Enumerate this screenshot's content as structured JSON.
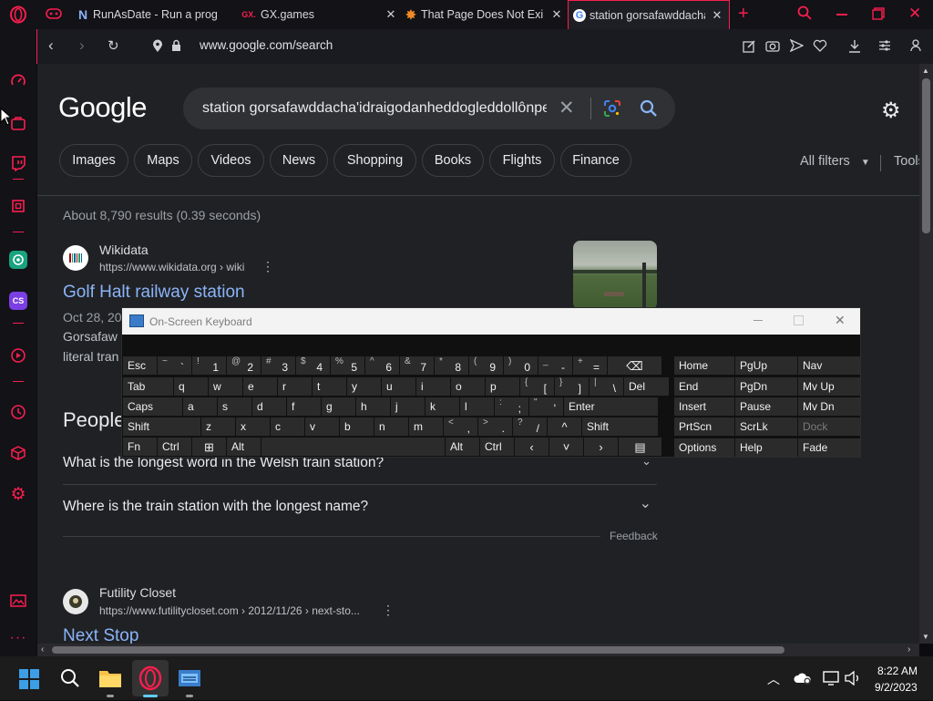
{
  "colors": {
    "accent": "#fa1e4e",
    "link": "#8ab4f8",
    "page_bg": "#202124"
  },
  "tabs": [
    {
      "title": "RunAsDate - Run a prog",
      "icon": "nirsoft-icon",
      "active": false
    },
    {
      "title": "GX.games",
      "icon": "gx-games-icon",
      "active": false
    },
    {
      "title": "That Page Does Not Exi",
      "icon": "star-splat-icon",
      "active": false
    },
    {
      "title": "station gorsafawddacha",
      "icon": "google-icon",
      "active": true
    }
  ],
  "address": {
    "url": "www.google.com/search"
  },
  "google": {
    "logo": "Google",
    "query": "station gorsafawddacha'idraigodanheddogleddollônpe",
    "chips": [
      "Images",
      "Maps",
      "Videos",
      "News",
      "Shopping",
      "Books",
      "Flights",
      "Finance"
    ],
    "all_filters": "All filters",
    "tools": "Tools",
    "stats": "About 8,790 results (0.39 seconds)"
  },
  "results": [
    {
      "site": "Wikidata",
      "url": "https://www.wikidata.org › wiki",
      "title": "Golf Halt railway station",
      "date": "Oct 28, 20",
      "snippet1": "Gorsafaw",
      "snippet2": "literal tran"
    },
    {
      "site": "Futility Closet",
      "url": "https://www.futilitycloset.com › 2012/11/26 › next-sto...",
      "title": "Next Stop"
    }
  ],
  "people_also_ask": {
    "heading": "People",
    "questions": [
      "What is the longest word in the Welsh train station?",
      "Where is the train station with the longest name?"
    ],
    "feedback": "Feedback"
  },
  "osk": {
    "title": "On-Screen Keyboard",
    "keys": {
      "row1": [
        {
          "main": "Esc"
        },
        {
          "shift": "~",
          "main": "`"
        },
        {
          "shift": "!",
          "main": "1"
        },
        {
          "shift": "@",
          "main": "2"
        },
        {
          "shift": "#",
          "main": "3"
        },
        {
          "shift": "$",
          "main": "4"
        },
        {
          "shift": "%",
          "main": "5"
        },
        {
          "shift": "^",
          "main": "6"
        },
        {
          "shift": "&",
          "main": "7"
        },
        {
          "shift": "*",
          "main": "8"
        },
        {
          "shift": "(",
          "main": "9"
        },
        {
          "shift": ")",
          "main": "0"
        },
        {
          "shift": "_",
          "main": "-"
        },
        {
          "shift": "+",
          "main": "="
        },
        {
          "main": "⌫"
        }
      ],
      "row2": [
        {
          "main": "Tab"
        },
        {
          "main": "q"
        },
        {
          "main": "w"
        },
        {
          "main": "e"
        },
        {
          "main": "r"
        },
        {
          "main": "t"
        },
        {
          "main": "y"
        },
        {
          "main": "u"
        },
        {
          "main": "i"
        },
        {
          "main": "o"
        },
        {
          "main": "p"
        },
        {
          "shift": "{",
          "main": "["
        },
        {
          "shift": "}",
          "main": "]"
        },
        {
          "shift": "|",
          "main": "\\"
        },
        {
          "main": "Del"
        }
      ],
      "row3": [
        {
          "main": "Caps"
        },
        {
          "main": "a"
        },
        {
          "main": "s"
        },
        {
          "main": "d"
        },
        {
          "main": "f"
        },
        {
          "main": "g"
        },
        {
          "main": "h"
        },
        {
          "main": "j"
        },
        {
          "main": "k"
        },
        {
          "main": "l"
        },
        {
          "shift": ":",
          "main": ";"
        },
        {
          "shift": "\"",
          "main": "'"
        },
        {
          "main": "Enter"
        }
      ],
      "row4": [
        {
          "main": "Shift"
        },
        {
          "main": "z"
        },
        {
          "main": "x"
        },
        {
          "main": "c"
        },
        {
          "main": "v"
        },
        {
          "main": "b"
        },
        {
          "main": "n"
        },
        {
          "main": "m"
        },
        {
          "shift": "<",
          "main": ","
        },
        {
          "shift": ">",
          "main": "."
        },
        {
          "shift": "?",
          "main": "/"
        },
        {
          "main": "^"
        },
        {
          "main": "Shift"
        }
      ],
      "row5": [
        {
          "main": "Fn"
        },
        {
          "main": "Ctrl"
        },
        {
          "main": "⊞"
        },
        {
          "main": "Alt"
        },
        {
          "main": ""
        },
        {
          "main": "Alt"
        },
        {
          "main": "Ctrl"
        },
        {
          "main": "‹"
        },
        {
          "main": "˅"
        },
        {
          "main": "›"
        },
        {
          "main": "▤"
        }
      ],
      "nav": [
        [
          "Home",
          "PgUp",
          "Nav"
        ],
        [
          "End",
          "PgDn",
          "Mv Up"
        ],
        [
          "Insert",
          "Pause",
          "Mv Dn"
        ],
        [
          "PrtScn",
          "ScrLk",
          "Dock"
        ],
        [
          "Options",
          "Help",
          "Fade"
        ]
      ]
    }
  },
  "taskbar": {
    "time": "8:22 AM",
    "date": "9/2/2023"
  }
}
